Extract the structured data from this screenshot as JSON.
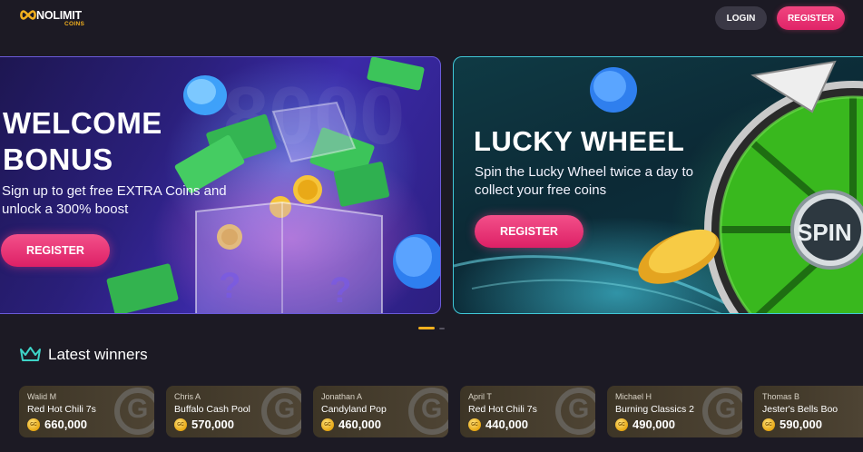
{
  "header": {
    "logo_main": "NOLIMIT",
    "logo_sub": "COINS",
    "login_label": "LOGIN",
    "register_label": "REGISTER"
  },
  "banners": [
    {
      "title_line1": "WELCOME",
      "title_line2": "BONUS",
      "text_line1": "Sign up to get free EXTRA Coins and",
      "text_line2": "unlock a 300% boost",
      "button_label": "REGISTER"
    },
    {
      "title_line1": "LUCKY WHEEL",
      "text_line1": "Spin the Lucky Wheel twice a day to",
      "text_line2": "collect your free coins",
      "button_label": "REGISTER",
      "wheel_label": "SPIN"
    }
  ],
  "winners": {
    "title": "Latest winners",
    "coin_label": "GC",
    "items": [
      {
        "name": "Walid M",
        "game": "Red Hot Chili 7s",
        "amount": "660,000"
      },
      {
        "name": "Chris A",
        "game": "Buffalo Cash Pool",
        "amount": "570,000"
      },
      {
        "name": "Jonathan A",
        "game": "Candyland Pop",
        "amount": "460,000"
      },
      {
        "name": "April T",
        "game": "Red Hot Chili 7s",
        "amount": "440,000"
      },
      {
        "name": "Michael H",
        "game": "Burning Classics 2",
        "amount": "490,000"
      },
      {
        "name": "Thomas B",
        "game": "Jester's Bells Boo",
        "amount": "590,000"
      }
    ]
  },
  "colors": {
    "background": "#1c1a24",
    "accent_pink": "#e02468",
    "coin_gold": "#f2b01e"
  }
}
